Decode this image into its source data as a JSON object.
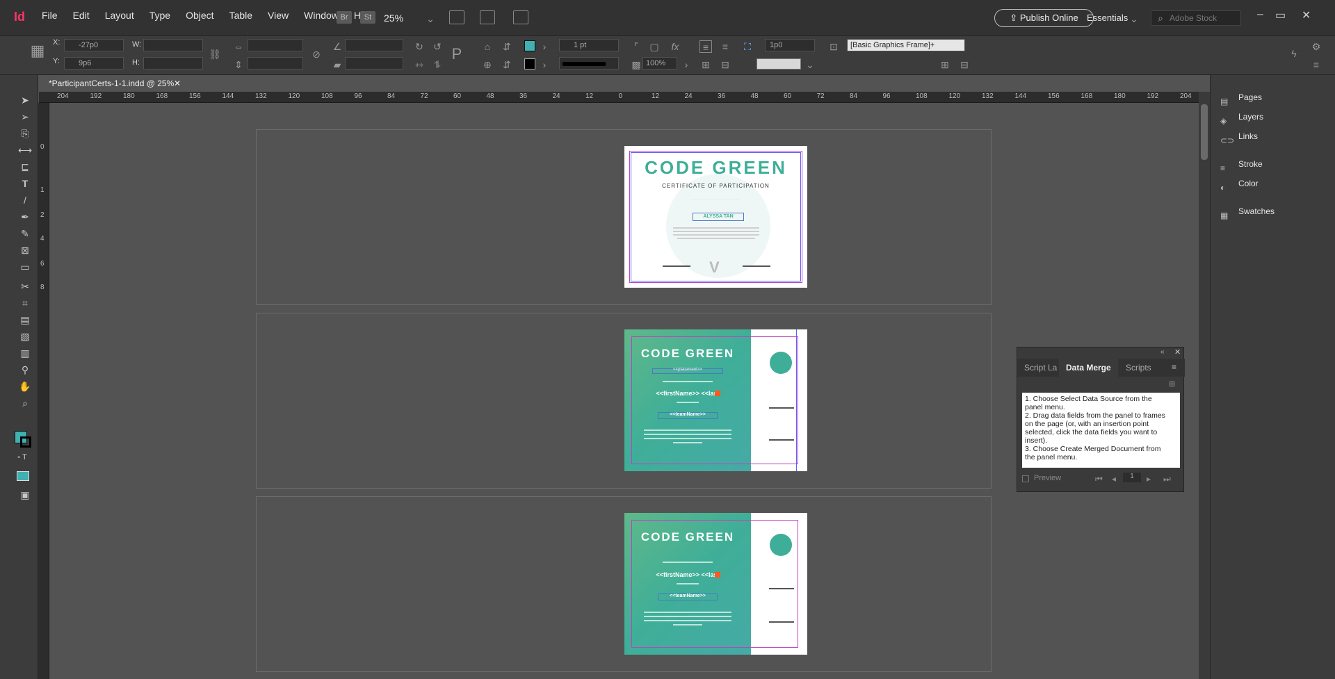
{
  "app": {
    "logo": "Id",
    "zoom": "25%",
    "bridge_badge": "Br",
    "stock_badge": "St"
  },
  "menu": [
    "File",
    "Edit",
    "Layout",
    "Type",
    "Object",
    "Table",
    "View",
    "Window",
    "Help"
  ],
  "topright": {
    "publish_label": "Publish Online",
    "workspace": "Essentials",
    "search_placeholder": "Adobe Stock"
  },
  "control": {
    "x_label": "X:",
    "x_value": "-27p0",
    "y_label": "Y:",
    "y_value": "9p6",
    "w_label": "W:",
    "h_label": "H:",
    "stroke_weight": "1 pt",
    "scale_percent": "100%",
    "gap_value": "1p0",
    "object_style": "[Basic Graphics Frame]+"
  },
  "document": {
    "tab_title": "*ParticipantCerts-1-1.indd @ 25%"
  },
  "ruler_h": [
    "204",
    "192",
    "180",
    "168",
    "156",
    "144",
    "132",
    "120",
    "108",
    "96",
    "84",
    "72",
    "60",
    "48",
    "36",
    "24",
    "12",
    "0",
    "12",
    "24",
    "36",
    "48",
    "60",
    "72",
    "84",
    "96",
    "108",
    "120",
    "132",
    "144",
    "156",
    "168",
    "180",
    "192",
    "204"
  ],
  "ruler_v": [
    "0",
    "1",
    "2",
    "4",
    "6",
    "8"
  ],
  "pages": [
    {
      "title": "CODE GREEN",
      "subtitle": "CERTIFICATE OF PARTICIPATION",
      "name": "ALYSSA TAN"
    },
    {
      "title": "CODE GREEN",
      "placement": "<<placement>>",
      "name": "<<firstName>> <<last",
      "team": "<<teamName>>"
    },
    {
      "title": "CODE GREEN",
      "name": "<<firstName>> <<last",
      "team": "<<teamName>>"
    }
  ],
  "data_merge": {
    "tabs": [
      "Script La",
      "Data Merge",
      "Scripts"
    ],
    "instructions": "1. Choose Select Data Source from the panel menu.\n2. Drag data fields from the panel to frames on the page (or, with an insertion point selected, click the data fields you want to insert).\n3. Choose Create Merged Document from the panel menu.",
    "preview_label": "Preview",
    "record": "1"
  },
  "dock": [
    "Pages",
    "Layers",
    "Links",
    "Stroke",
    "Color",
    "Swatches"
  ],
  "colors": {
    "accent": "#3fae98",
    "fill_swatch": "#40b0b0"
  }
}
